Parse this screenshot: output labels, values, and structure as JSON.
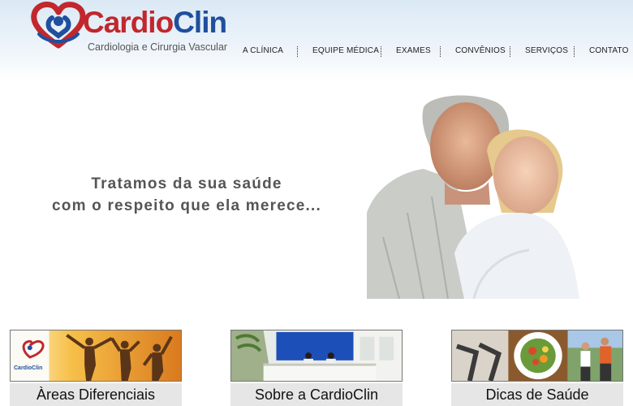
{
  "brand": {
    "name_part1": "Cardio",
    "name_part2": "Clin",
    "tagline": "Cardiologia e Cirurgia Vascular",
    "primary_color": "#c1272d",
    "secondary_color": "#1f4f9e"
  },
  "nav": {
    "items": [
      {
        "label": "A CLÍNICA"
      },
      {
        "label": "EQUIPE MÉDICA"
      },
      {
        "label": "EXAMES"
      },
      {
        "label": "CONVÊNIOS"
      },
      {
        "label": "SERVIÇOS"
      },
      {
        "label": "CONTATO"
      }
    ]
  },
  "hero": {
    "line1": "Tratamos da sua saúde",
    "line2": "com o respeito que ela merece...",
    "photo": "elderly-couple-photo"
  },
  "cards": [
    {
      "label": "Àreas Diferenciais",
      "image": "people-jumping-sunset-photo",
      "logo_text": "CardioClin"
    },
    {
      "label": "Sobre a CardioClin",
      "image": "clinic-reception-photo"
    },
    {
      "label": "Dicas de Saúde",
      "image": "health-fitness-food-photo"
    }
  ]
}
